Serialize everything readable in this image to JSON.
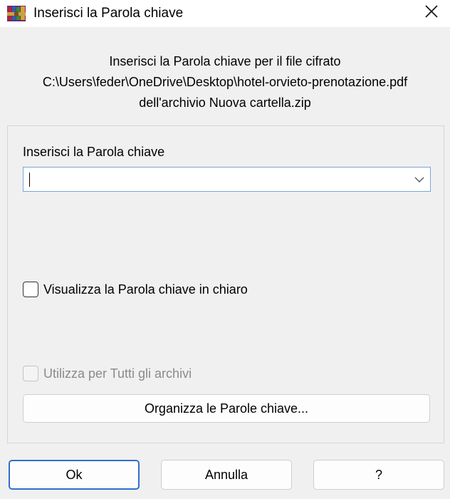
{
  "titlebar": {
    "title": "Inserisci la Parola chiave",
    "app_icon": "winrar-books-icon",
    "close_icon": "close-icon"
  },
  "message": {
    "line1": "Inserisci la Parola chiave per il file cifrato",
    "line2": "C:\\Users\\feder\\OneDrive\\Desktop\\hotel-orvieto-prenotazione.pdf",
    "line3": "dell'archivio Nuova cartella.zip"
  },
  "password": {
    "label": "Inserisci la Parola chiave",
    "value": "",
    "dropdown_icon": "chevron-down-icon"
  },
  "options": {
    "show_password_label": "Visualizza la Parola chiave in chiaro",
    "show_password_checked": false,
    "use_all_label": "Utilizza per Tutti gli archivi",
    "use_all_checked": false,
    "use_all_enabled": false
  },
  "buttons": {
    "organize": "Organizza le Parole chiave...",
    "ok": "Ok",
    "cancel": "Annulla",
    "help": "?"
  },
  "colors": {
    "focus_border": "#2f6fcf",
    "input_border": "#7aa6d6"
  }
}
